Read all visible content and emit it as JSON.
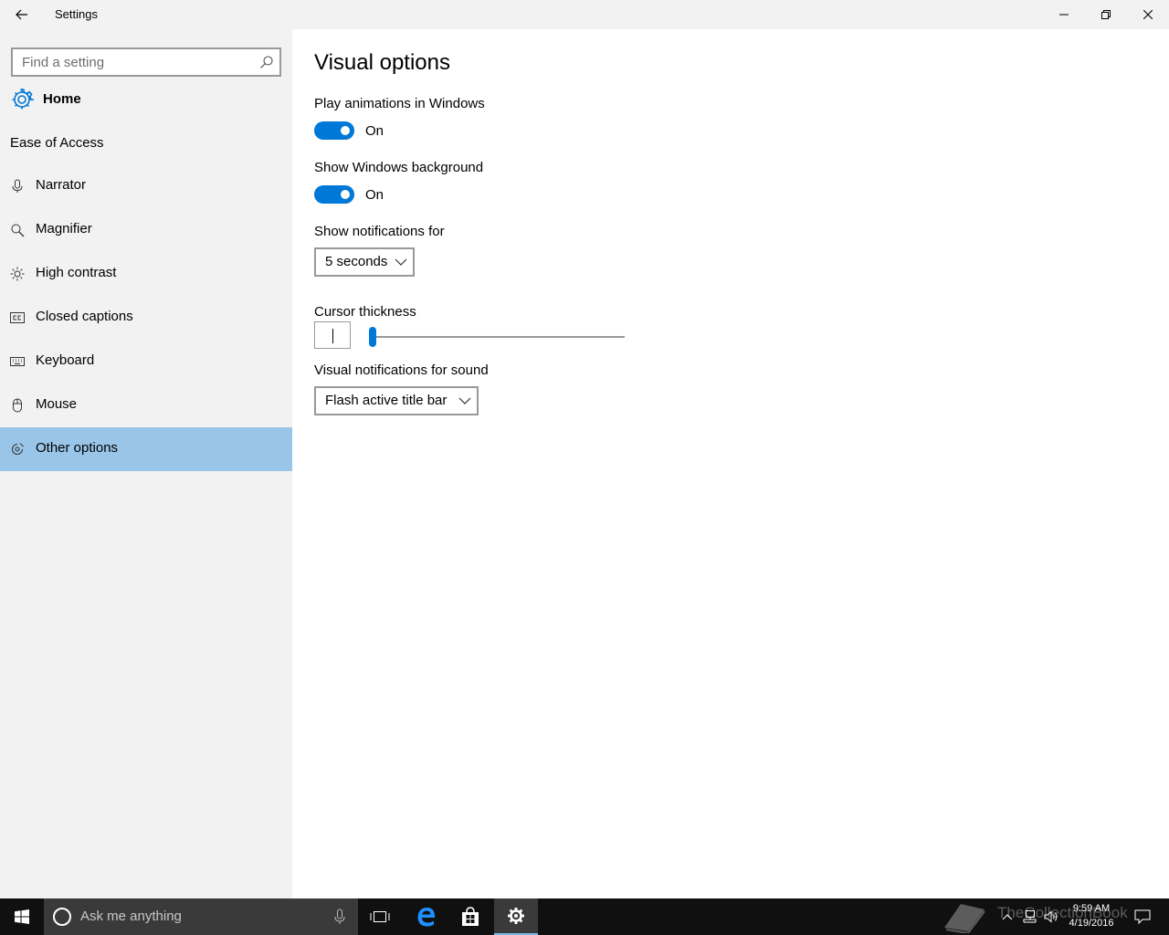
{
  "window": {
    "title": "Settings",
    "controls": {
      "minimize": "minimize",
      "maximize": "restore",
      "close": "close"
    }
  },
  "sidebar": {
    "search": {
      "placeholder": "Find a setting",
      "icon": "search-icon"
    },
    "home": {
      "label": "Home",
      "icon": "gear-icon"
    },
    "section_title": "Ease of Access",
    "items": [
      {
        "label": "Narrator",
        "icon": "microphone-icon",
        "active": false
      },
      {
        "label": "Magnifier",
        "icon": "magnifier-icon",
        "active": false
      },
      {
        "label": "High contrast",
        "icon": "sun-icon",
        "active": false
      },
      {
        "label": "Closed captions",
        "icon": "cc-icon",
        "active": false
      },
      {
        "label": "Keyboard",
        "icon": "keyboard-icon",
        "active": false
      },
      {
        "label": "Mouse",
        "icon": "mouse-icon",
        "active": false
      },
      {
        "label": "Other options",
        "icon": "other-options-icon",
        "active": true
      }
    ]
  },
  "main": {
    "title": "Visual options",
    "animations": {
      "label": "Play animations in Windows",
      "state": "On",
      "enabled": true
    },
    "background": {
      "label": "Show Windows background",
      "state": "On",
      "enabled": true
    },
    "notifications": {
      "label": "Show notifications for",
      "value": "5 seconds"
    },
    "cursor": {
      "label": "Cursor thickness",
      "value_fraction": 0.0
    },
    "sound": {
      "label": "Visual notifications for sound",
      "value": "Flash active title bar"
    }
  },
  "taskbar": {
    "search_placeholder": "Ask me anything",
    "pinned": [
      "task-view-icon",
      "edge-icon",
      "store-icon",
      "settings-icon"
    ],
    "active_app": "settings-icon",
    "clock": {
      "time": "9:59 AM",
      "date": "4/19/2016"
    },
    "watermark": "TheCollectionBook"
  },
  "colors": {
    "accent": "#0078d7",
    "sidebar_bg": "#f2f2f2",
    "active_item_bg": "#99c5e8",
    "taskbar_bg": "#101010"
  }
}
